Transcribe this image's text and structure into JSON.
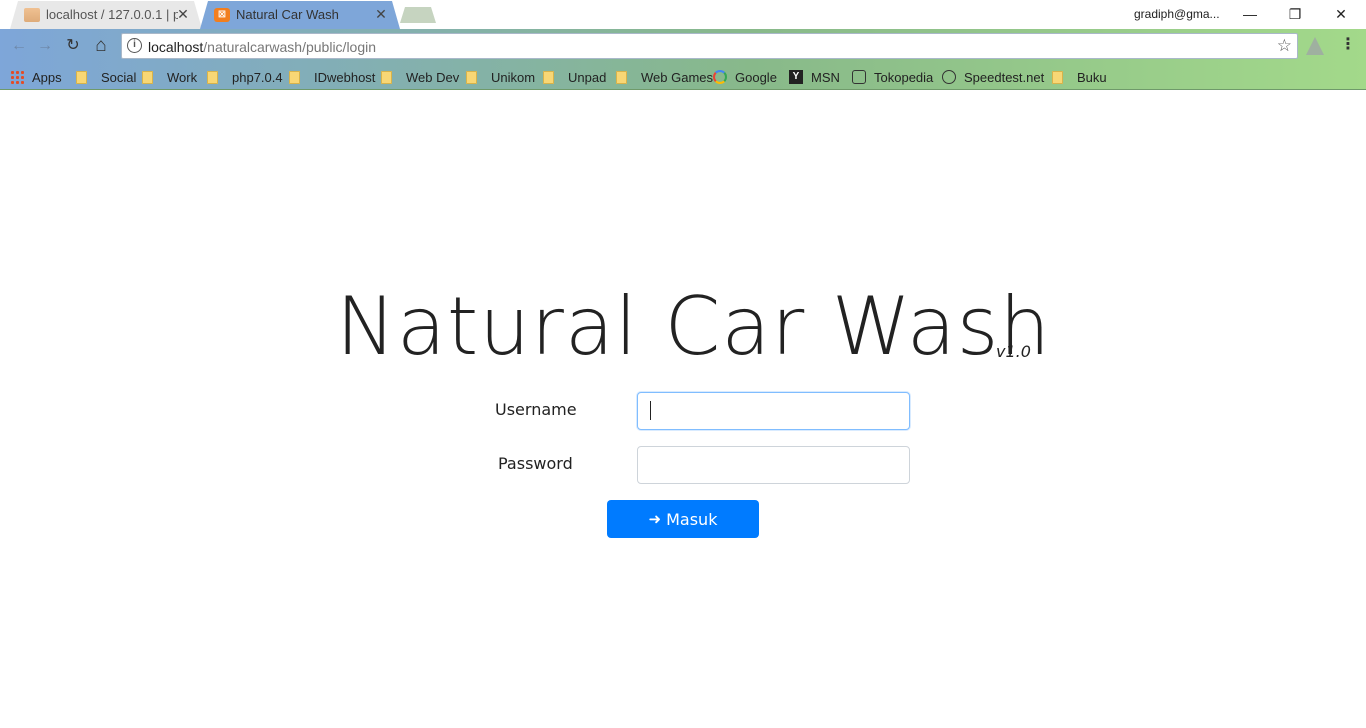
{
  "browser": {
    "tabs": [
      {
        "title": "localhost / 127.0.0.1 | phpMyAdmin",
        "favicon": "phpmyadmin-icon",
        "active": false
      },
      {
        "title": "Natural Car Wash",
        "favicon": "xampp-icon",
        "active": true
      }
    ],
    "profile": "gradiph@gma...",
    "window_controls": {
      "minimize": "—",
      "restore": "❐",
      "close": "✕"
    },
    "nav": {
      "back": "←",
      "forward": "→",
      "reload": "↻",
      "home": "⌂"
    },
    "omnibox": {
      "host": "localhost",
      "path": "/naturalcarwash/public/login",
      "info": "i",
      "star": "☆"
    },
    "menu": "⋮",
    "bookmarks": [
      {
        "label": "Apps",
        "icon": "apps-grid-icon"
      },
      {
        "label": "Social",
        "icon": "folder-icon"
      },
      {
        "label": "Work",
        "icon": "folder-icon"
      },
      {
        "label": "php7.0.4",
        "icon": "folder-icon"
      },
      {
        "label": "IDwebhost",
        "icon": "folder-icon"
      },
      {
        "label": "Web Dev",
        "icon": "folder-icon"
      },
      {
        "label": "Unikom",
        "icon": "folder-icon"
      },
      {
        "label": "Unpad",
        "icon": "folder-icon"
      },
      {
        "label": "Web Games",
        "icon": "folder-icon"
      },
      {
        "label": "Google",
        "icon": "google-icon"
      },
      {
        "label": "MSN",
        "icon": "msn-icon"
      },
      {
        "label": "Tokopedia",
        "icon": "tokopedia-icon"
      },
      {
        "label": "Speedtest.net",
        "icon": "speedtest-icon"
      },
      {
        "label": "Buku",
        "icon": "folder-icon"
      }
    ]
  },
  "page": {
    "title": "Natural Car Wash",
    "version": "v1.0",
    "username_label": "Username",
    "username_value": "",
    "password_label": "Password",
    "password_value": "",
    "submit_label": "Masuk",
    "submit_icon": "sign-in-icon",
    "accent_color": "#007bff"
  }
}
